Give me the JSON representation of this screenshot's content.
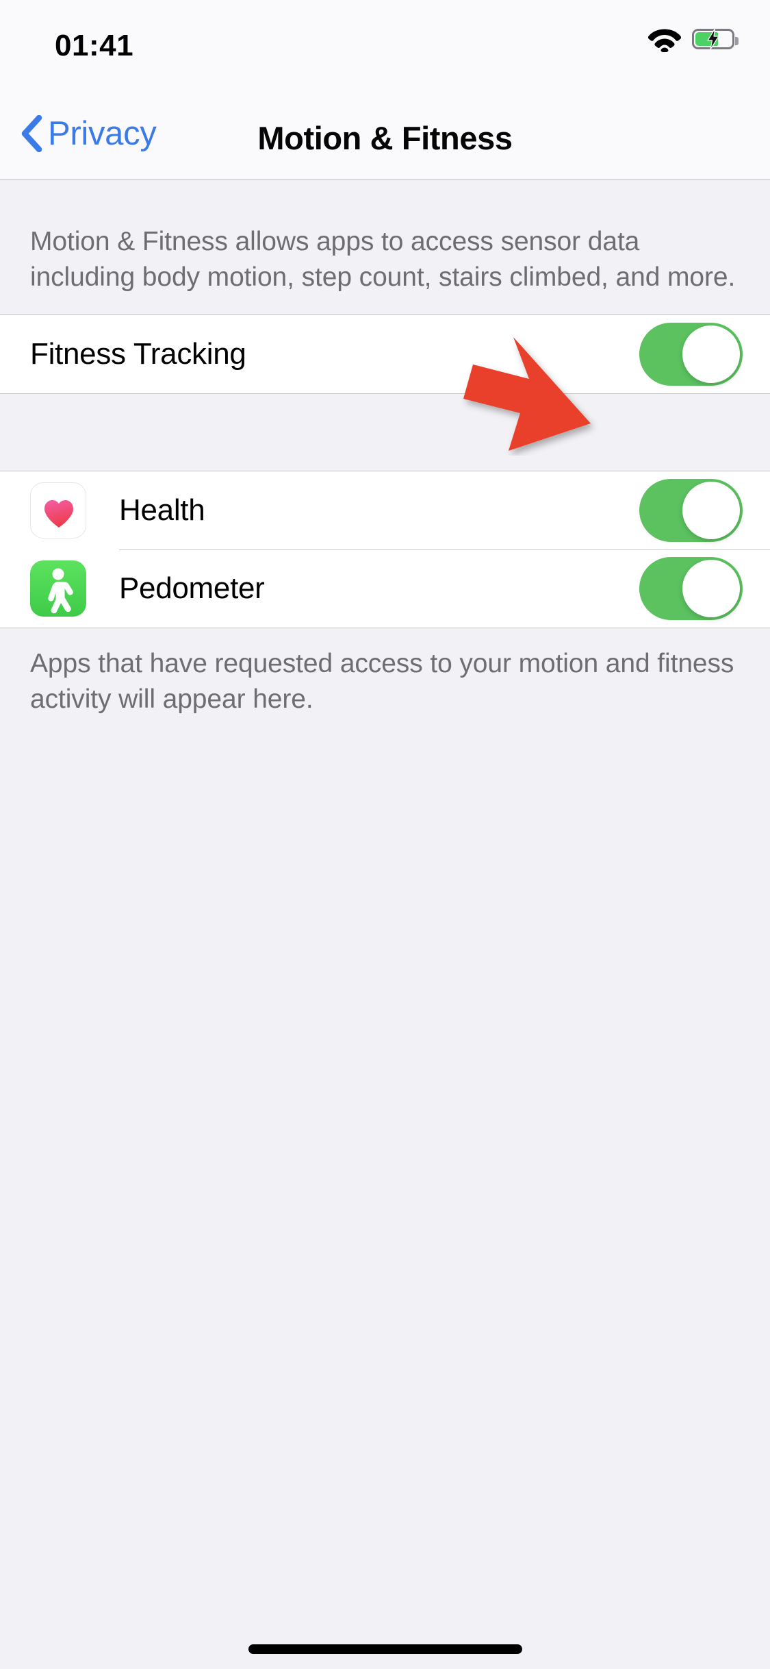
{
  "status_bar": {
    "time": "01:41",
    "wifi_icon": "wifi-icon",
    "battery_icon": "battery-charging-icon",
    "battery_charging": true
  },
  "nav": {
    "back_label": "Privacy",
    "back_icon": "chevron-left-icon",
    "title": "Motion & Fitness",
    "accent_color": "#3B7BE8"
  },
  "main": {
    "description": "Motion & Fitness allows apps to access sensor data including body motion, step count, stairs climbed, and more.",
    "fitness_tracking": {
      "label": "Fitness Tracking",
      "toggle_state": "on"
    },
    "apps": [
      {
        "label": "Health",
        "icon": "heart-icon",
        "toggle_state": "on"
      },
      {
        "label": "Pedometer",
        "icon": "walking-person-icon",
        "toggle_state": "on"
      }
    ],
    "footer": "Apps that have requested access to your motion and fitness activity will appear here."
  },
  "annotation": {
    "arrow_icon": "red-arrow-right-icon",
    "arrow_color": "#E8412A"
  },
  "colors": {
    "toggle_on": "#5BC25F",
    "page_background": "#F2F1F6",
    "row_background": "#FFFFFF",
    "secondary_text": "#6D6D72"
  },
  "home_indicator": "home-indicator"
}
